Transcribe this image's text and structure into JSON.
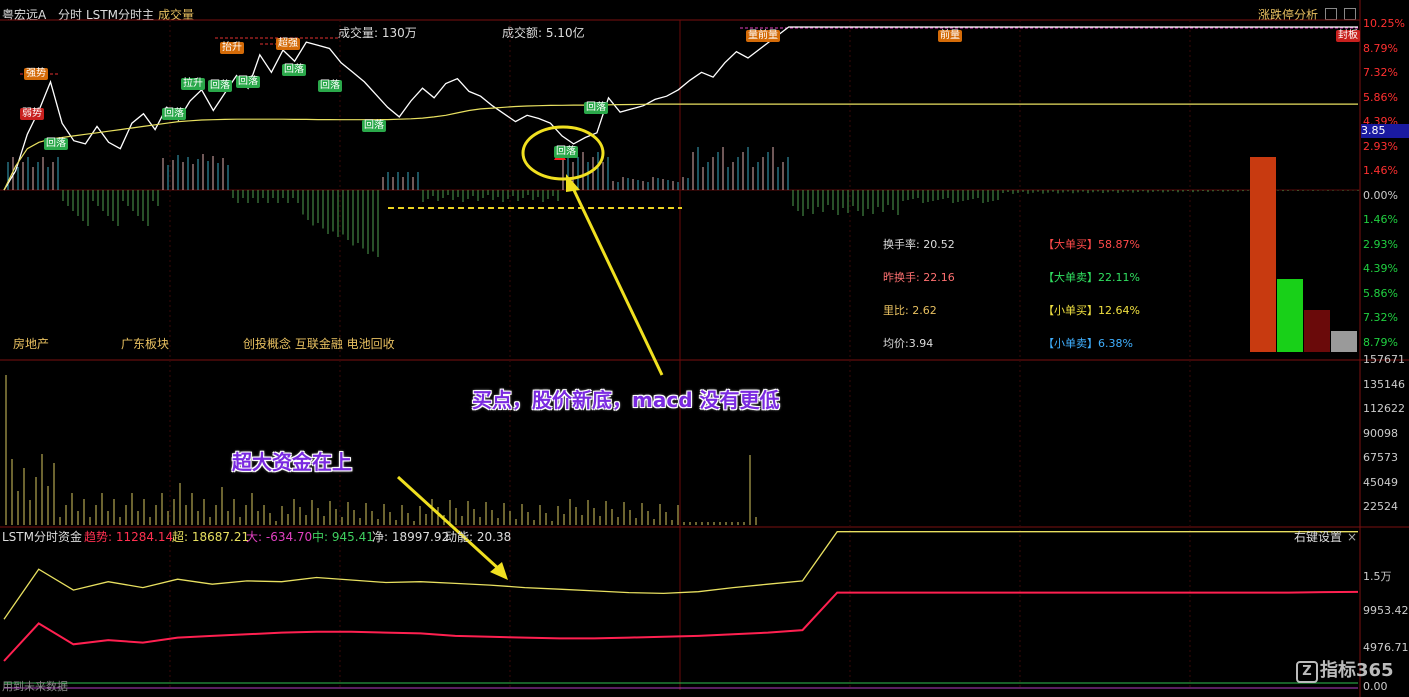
{
  "header": {
    "stock_name": "粤宏远A",
    "mode": "分时",
    "indicator": "LSTM分时主",
    "volume_tab": "成交量",
    "volume_info": "成交量: 130万",
    "amount_info": "成交额: 5.10亿",
    "right_button": "涨跌停分析"
  },
  "price_axis": {
    "labels": [
      "10.25%",
      "8.79%",
      "7.32%",
      "5.86%",
      "4.39%",
      "2.93%",
      "1.46%",
      "0.00%",
      "1.46%",
      "2.93%",
      "4.39%",
      "5.86%",
      "7.32%",
      "8.79%"
    ],
    "current_price": "3.85",
    "colors": [
      "#ff3030",
      "#ff3030",
      "#ff3030",
      "#ff3030",
      "#ff3030",
      "#ff3030",
      "#ff3030",
      "#cccccc",
      "#20d040",
      "#20d040",
      "#20d040",
      "#20d040",
      "#20d040",
      "#20d040"
    ]
  },
  "volume_axis": {
    "labels": [
      "157671",
      "135146",
      "112622",
      "90098",
      "67573",
      "45049",
      "22524"
    ]
  },
  "fund_axis": {
    "labels": [
      "1.5万",
      "9953.42",
      "4976.71",
      "0.00"
    ]
  },
  "stats": {
    "turnover": "换手率: 20.52",
    "prev_turnover": "昨换手: 22.16",
    "volume_ratio": "里比: 2.62",
    "avg_price": "均价:3.94",
    "big_buy": "【大单买】58.87%",
    "big_sell": "【大单卖】22.11%",
    "small_buy": "【小单买】12.64%",
    "small_sell": "【小单卖】6.38%"
  },
  "sectors": [
    "房地产",
    "广东板块",
    "创投概念 互联金融 电池回收"
  ],
  "fund_panel": {
    "title": "LSTM分时资金",
    "trend": "趋势: 11284.14",
    "super": "超: 18687.21",
    "big": "大: -634.70",
    "mid": "中: 945.41",
    "net": "净: 18997.92",
    "momentum": "动能: 20.38",
    "right_button": "右键设置",
    "close": "×"
  },
  "annotations": {
    "buy_point": "买点，股价新底，macd 没有更低",
    "super_fund": "超大资金在上"
  },
  "signal_tags": {
    "strong": "强势",
    "weak": "弱势",
    "retrace": "回落",
    "pull": "拉升",
    "lift": "抬升",
    "vol_front": "量前量",
    "front_vol": "前量",
    "seal": "封板",
    "upper_strong": "超强",
    "buy": "买"
  },
  "footer": {
    "left_note": "用到未来数据",
    "watermark": "指标365"
  },
  "chart_data": [
    {
      "type": "bar",
      "title": "涨跌停分析",
      "categories": [
        "大单买",
        "大单卖",
        "小单买",
        "小单卖"
      ],
      "values": [
        58.87,
        22.11,
        12.64,
        6.38
      ],
      "colors": [
        "#c83a10",
        "#18d018",
        "#6a0a0a",
        "#9a9a9a"
      ]
    },
    {
      "type": "line",
      "title": "分时",
      "ylabel": "%",
      "ylim": [
        -8.79,
        10.25
      ],
      "series": [
        {
          "name": "price",
          "color": "#ffffff",
          "values": [
            0.0,
            1.2,
            3.5,
            5.0,
            6.8,
            4.2,
            3.1,
            2.9,
            4.0,
            3.0,
            2.6,
            4.2,
            4.8,
            3.8,
            5.2,
            4.4,
            5.6,
            6.3,
            5.0,
            6.1,
            7.2,
            6.4,
            8.5,
            7.4,
            8.8,
            8.1,
            9.3,
            9.1,
            8.9,
            8.0,
            7.4,
            6.8,
            6.0,
            5.2,
            4.6,
            5.6,
            6.4,
            5.8,
            6.7,
            7.0,
            6.2,
            5.9,
            5.3,
            4.8,
            4.3,
            4.7,
            4.5,
            4.2,
            3.4,
            2.9,
            3.3,
            3.6,
            5.8,
            4.9,
            5.1,
            5.3,
            5.7,
            5.9,
            6.3,
            6.9,
            7.4,
            7.1,
            8.0,
            8.7,
            8.3,
            10.25,
            10.25,
            10.25,
            10.25,
            10.25,
            10.25,
            10.25,
            10.25,
            10.25,
            10.25,
            10.25,
            10.25,
            10.25,
            10.25,
            10.25
          ]
        },
        {
          "name": "avg",
          "color": "#e8e060",
          "values": [
            0.0,
            1.5,
            2.6,
            3.0,
            3.2,
            3.3,
            3.4,
            3.5,
            3.6,
            3.7,
            3.8,
            3.9,
            4.0,
            4.1,
            4.2,
            4.3,
            4.35,
            4.4,
            4.42,
            4.44,
            4.45,
            4.45,
            4.45,
            4.45,
            4.45,
            4.44,
            4.44,
            4.43,
            4.43,
            4.42,
            4.42,
            4.42,
            4.42,
            4.43,
            4.45,
            4.48,
            4.52,
            4.6,
            4.7,
            4.85,
            5.0,
            5.1,
            5.15,
            5.2,
            5.25,
            5.28,
            5.3,
            5.32,
            5.33,
            5.34,
            5.34,
            5.35,
            5.36,
            5.37,
            5.38,
            5.39,
            5.4,
            5.4,
            5.4,
            5.4,
            5.4,
            5.4,
            5.4,
            5.4,
            5.4,
            5.4,
            5.4,
            5.4,
            5.4,
            5.4,
            5.4,
            5.4,
            5.4,
            5.4,
            5.4,
            5.4,
            5.4,
            5.4,
            5.4,
            5.4
          ]
        }
      ]
    },
    {
      "type": "line",
      "title": "LSTM分时资金",
      "ylim": [
        0,
        17500
      ],
      "series": [
        {
          "name": "超",
          "color": "#e8e060",
          "values": [
            8000,
            14000,
            11500,
            12500,
            11800,
            12800,
            12200,
            12600,
            12500,
            13000,
            12700,
            12400,
            12500,
            12300,
            12100,
            11800,
            11600,
            11400,
            11200,
            11100,
            11300,
            11800,
            12200,
            12600,
            18500,
            18500,
            18500,
            18500,
            18500,
            18500,
            18500,
            18500,
            18500,
            18500,
            18500,
            18500,
            18500,
            18500,
            18500,
            18500
          ]
        },
        {
          "name": "趋势",
          "color": "#ff2050",
          "values": [
            3000,
            7500,
            5000,
            5500,
            5200,
            5800,
            6000,
            6200,
            6400,
            6500,
            6500,
            6400,
            6300,
            6000,
            5900,
            5800,
            5700,
            5700,
            5800,
            5900,
            6000,
            6200,
            6400,
            6700,
            11200,
            11200,
            11200,
            11200,
            11200,
            11200,
            11200,
            11200,
            11200,
            11200,
            11200,
            11200,
            11200,
            11200,
            11250,
            11284
          ]
        }
      ]
    }
  ]
}
